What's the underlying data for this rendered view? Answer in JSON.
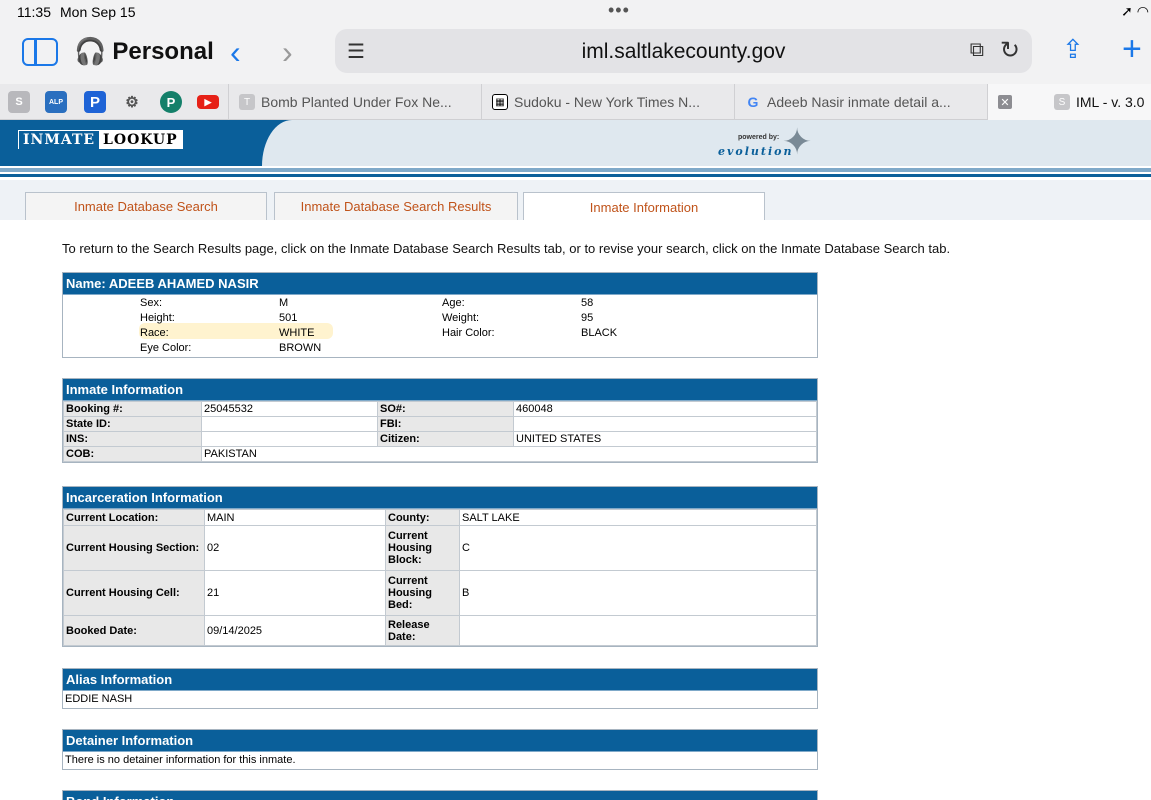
{
  "status": {
    "time": "11:35",
    "date": "Mon Sep 15",
    "dots": "•••",
    "system": "➚ ◠"
  },
  "browser": {
    "profile": "Personal",
    "url": "iml.saltlakecounty.gov",
    "pinned": [
      "S",
      "ALP",
      "P",
      "⚙",
      "P",
      "▶"
    ],
    "tabs": [
      {
        "icon": "T",
        "title": "Bomb Planted Under Fox Ne..."
      },
      {
        "icon": "▦",
        "title": "Sudoku - New York Times N..."
      },
      {
        "icon": "G",
        "title": "Adeeb Nasir inmate detail a...",
        "close": "✕"
      },
      {
        "icon": "S",
        "title": "IML - v. 3.0"
      }
    ]
  },
  "site": {
    "logo_word1": "INMATE",
    "logo_word2": "LOOKUP",
    "powered_by": "powered by:",
    "vendor": "evolution"
  },
  "page_tabs": [
    "Inmate Database Search",
    "Inmate Database Search Results",
    "Inmate Information"
  ],
  "intro": "To return to the Search Results page, click on the Inmate Database Search Results tab, or to revise your search, click on the Inmate Database Search tab.",
  "name_panel": {
    "title": "Name: ADEEB AHAMED NASIR",
    "sex_label": "Sex:",
    "sex": "M",
    "height_label": "Height:",
    "height": "501",
    "race_label": "Race:",
    "race": "WHITE",
    "eye_label": "Eye Color:",
    "eye": "BROWN",
    "age_label": "Age:",
    "age": "58",
    "weight_label": "Weight:",
    "weight": "95",
    "hair_label": "Hair Color:",
    "hair": "BLACK"
  },
  "inmate_info": {
    "title": "Inmate Information",
    "rows": [
      [
        "Booking #:",
        "25045532",
        "SO#:",
        "460048"
      ],
      [
        "State ID:",
        "",
        "FBI:",
        ""
      ],
      [
        "INS:",
        "",
        "Citizen:",
        "UNITED STATES"
      ],
      [
        "COB:",
        "PAKISTAN"
      ]
    ]
  },
  "incarceration": {
    "title": "Incarceration Information",
    "rows": [
      [
        "Current Location:",
        "MAIN",
        "County:",
        "SALT LAKE"
      ],
      [
        "Current Housing Section:",
        "02",
        "Current Housing Block:",
        "C"
      ],
      [
        "Current Housing Cell:",
        "21",
        "Current Housing Bed:",
        "B"
      ],
      [
        "Booked Date:",
        "09/14/2025",
        "Release Date:",
        ""
      ]
    ]
  },
  "alias": {
    "title": "Alias Information",
    "value": "EDDIE NASH"
  },
  "detainer": {
    "title": "Detainer Information",
    "value": "There is no detainer information for this inmate."
  },
  "bond": {
    "title": "Bond Information"
  }
}
